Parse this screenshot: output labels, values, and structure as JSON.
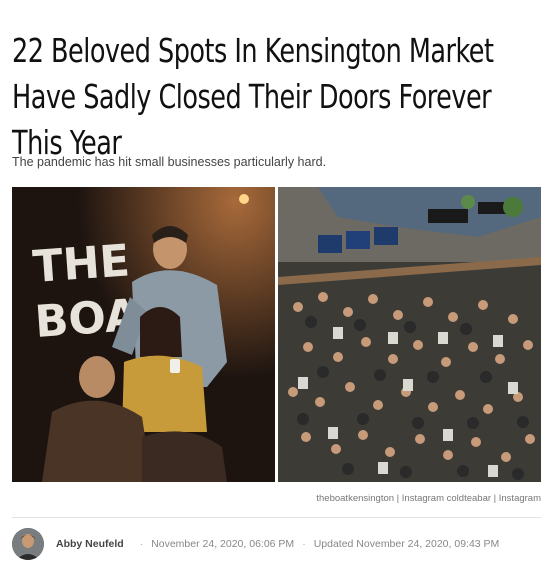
{
  "article": {
    "headline": "22 Beloved Spots In Kensington Market Have Sadly Closed Their Doors Forever This Year",
    "subhead": "The pandemic has hit small businesses particularly hard.",
    "photo_credit": "theboatkensington | Instagram coldteabar | Instagram",
    "left_photo_sign": [
      "THE",
      "BOAT"
    ],
    "byline": {
      "author": "Abby Neufeld",
      "separator": "·",
      "published": "November 24, 2020, 06:06 PM",
      "updated": "Updated November 24, 2020, 09:43 PM"
    }
  },
  "colors": {
    "headline": "#111111",
    "meta_text": "#888888"
  }
}
